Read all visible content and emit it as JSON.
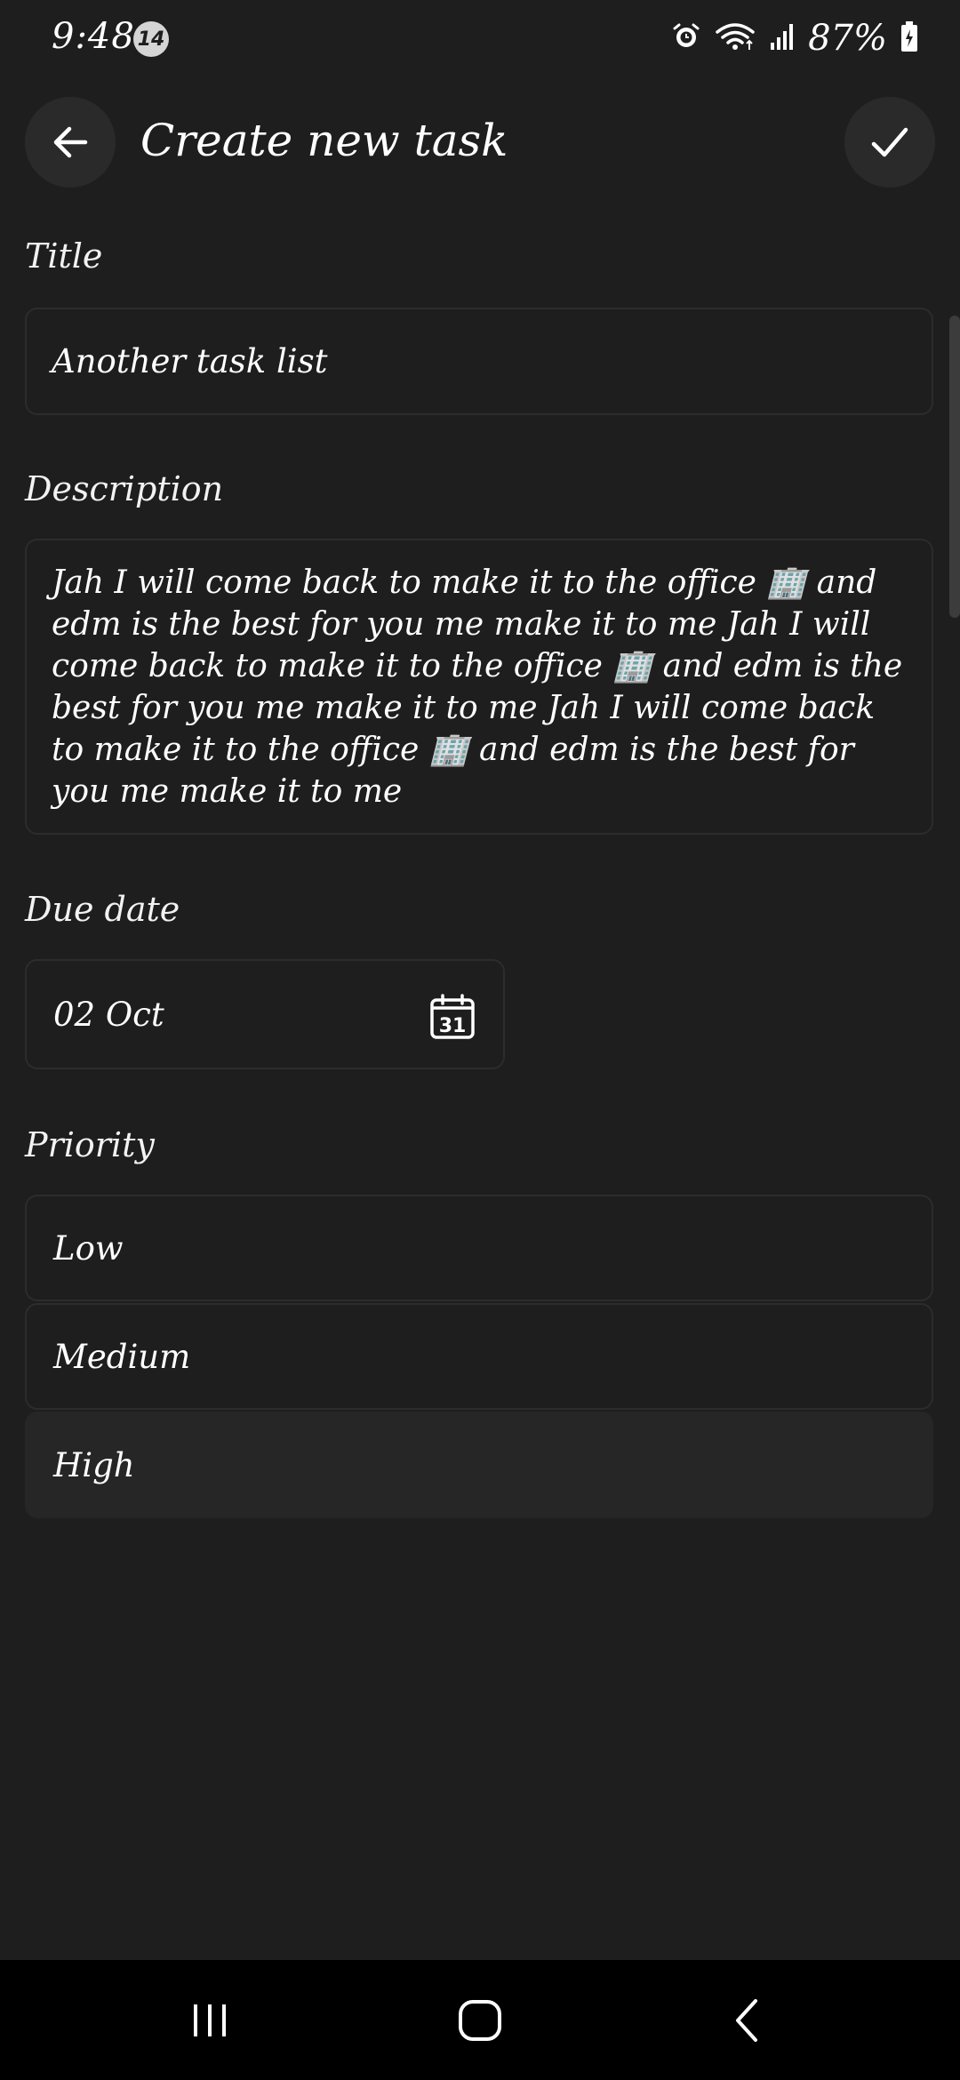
{
  "status_bar": {
    "time": "9:48",
    "notification_count": "14",
    "battery": "87%"
  },
  "header": {
    "title": "Create new task"
  },
  "form": {
    "title_label": "Title",
    "title_value": "Another task list",
    "description_label": "Description",
    "description_value": "Jah I will come back to make it to the office 🏢 and edm is the best for you me make it to me Jah I will come back to make it to the office 🏢 and edm is the best for you me make it to me Jah I will come back to make it to the office 🏢 and edm is the best for you me make it to me",
    "due_date_label": "Due date",
    "due_date_value": "02 Oct",
    "calendar_day": "31",
    "priority_label": "Priority",
    "priority_options": [
      "Low",
      "Medium",
      "High"
    ],
    "selected_priority": "High"
  },
  "icons": {
    "back": "arrow-left-icon",
    "done": "check-icon",
    "calendar": "calendar-icon"
  }
}
